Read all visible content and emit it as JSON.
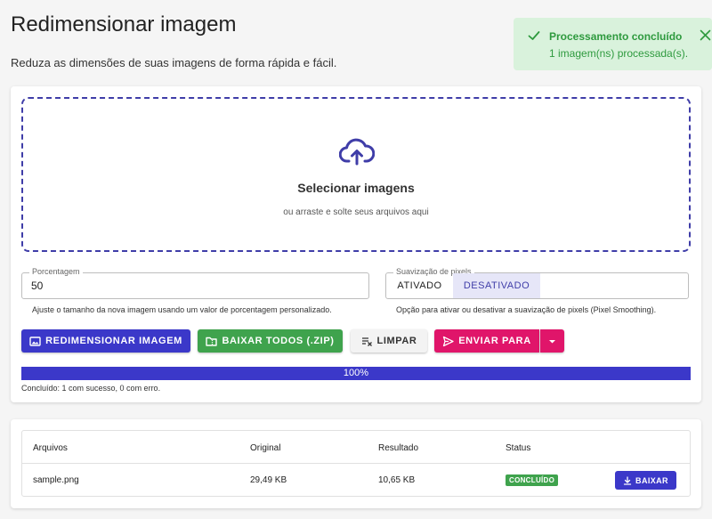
{
  "page": {
    "title": "Redimensionar imagem",
    "subtitle": "Reduza as dimensões de suas imagens de forma rápida e fácil."
  },
  "toast": {
    "title": "Processamento concluído",
    "message": "1 imagem(ns) processada(s).",
    "color": "#2e9a3e",
    "icon": "check-icon",
    "close_icon": "close-icon"
  },
  "dropzone": {
    "icon": "cloud-upload-icon",
    "title": "Selecionar imagens",
    "subtitle": "ou arraste e solte seus arquivos aqui"
  },
  "percentage": {
    "label": "Porcentagem",
    "value": "50",
    "helper": "Ajuste o tamanho da nova imagem usando um valor de porcentagem personalizado."
  },
  "smoothing": {
    "label": "Suavização de pixels",
    "options": [
      "ATIVADO",
      "DESATIVADO"
    ],
    "selected": "DESATIVADO",
    "helper": "Opção para ativar ou desativar a suavização de pixels (Pixel Smoothing)."
  },
  "actions": {
    "resize": "REDIMENSIONAR IMAGEM",
    "download_all": "BAIXAR TODOS (.ZIP)",
    "clear": "LIMPAR",
    "send_to": "ENVIAR PARA"
  },
  "progress": {
    "value": 1.0,
    "label": "100%",
    "status": "Concluído: 1 com sucesso, 0 com erro."
  },
  "table": {
    "columns": [
      "Arquivos",
      "Original",
      "Resultado",
      "Status"
    ],
    "rows": [
      {
        "file": "sample.png",
        "original": "29,49 KB",
        "result": "10,65 KB",
        "status": "CONCLUÍDO",
        "action": "BAIXAR"
      }
    ]
  },
  "colors": {
    "primary": "#3b38c9",
    "success": "#3fa34d",
    "accent": "#e0156a"
  }
}
